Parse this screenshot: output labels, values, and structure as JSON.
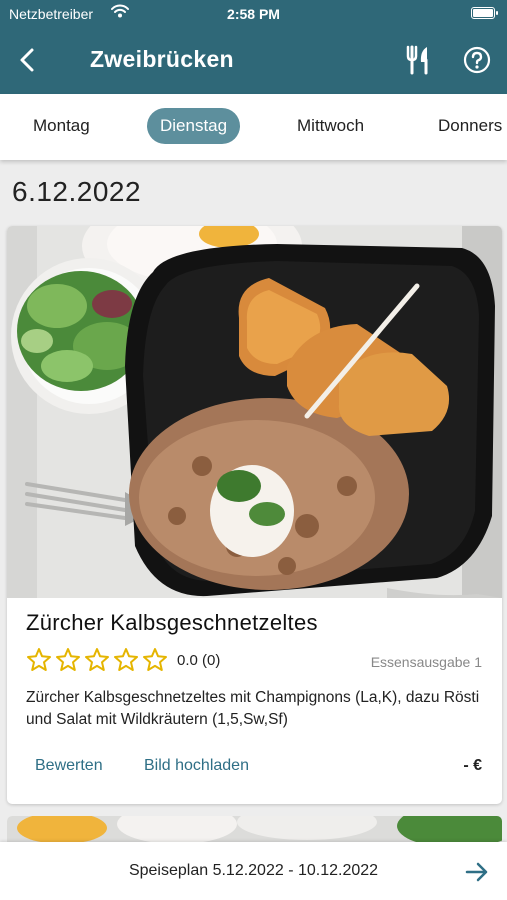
{
  "status_bar": {
    "carrier": "Netzbetreiber",
    "time": "2:58 PM"
  },
  "header": {
    "title": "Zweibrücken"
  },
  "tabs": [
    {
      "label": "Montag"
    },
    {
      "label": "Dienstag",
      "selected": true
    },
    {
      "label": "Mittwoch"
    },
    {
      "label": "Donners"
    }
  ],
  "date": "6.12.2022",
  "meal": {
    "title": "Zürcher Kalbsgeschnetzeltes",
    "rating": "0.0 (0)",
    "stars_filled": 0,
    "stars_total": 5,
    "counter": "Essensausgabe 1",
    "description": "Zürcher Kalbsgeschnetzeltes mit Champignons (La,K), dazu Rösti und Salat mit Wildkräutern (1,5,Sw,Sf)",
    "rate_label": "Bewerten",
    "upload_label": "Bild hochladen",
    "price": "- €"
  },
  "footer": {
    "range": "Speiseplan 5.12.2022 - 10.12.2022"
  },
  "colors": {
    "primary": "#2f6878",
    "tab_selected": "#5d8f9d",
    "star": "#e5b500",
    "link": "#2f6f86"
  }
}
